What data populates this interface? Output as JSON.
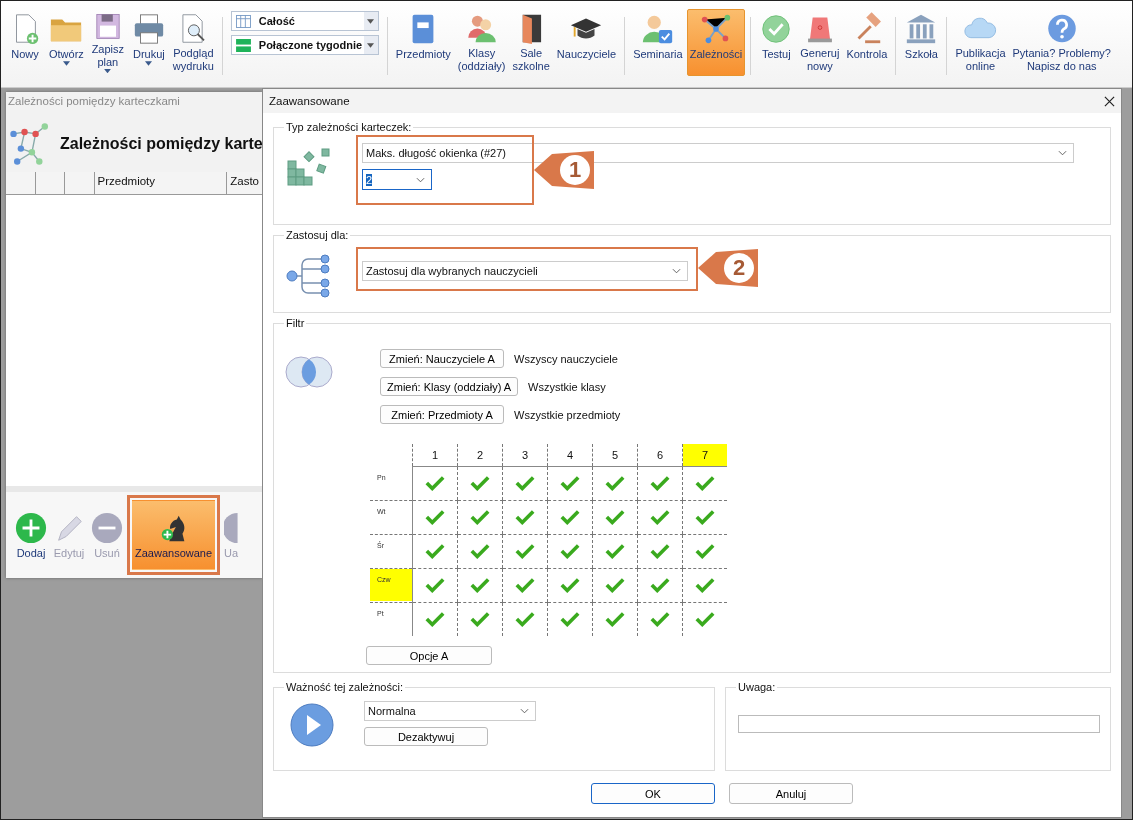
{
  "toolbar": {
    "groups": [
      [
        {
          "kind": "button",
          "label": "Nowy",
          "menu": false,
          "selected": false
        },
        {
          "kind": "button",
          "label": "Otwórz",
          "menu": true,
          "selected": false
        },
        {
          "kind": "button",
          "label": "Zapisz\nplan",
          "menu": true,
          "selected": false
        },
        {
          "kind": "button",
          "label": "Drukuj",
          "menu": true,
          "selected": false
        },
        {
          "kind": "button",
          "label": "Podgląd\nwydruku",
          "menu": false,
          "selected": false
        }
      ],
      [
        {
          "kind": "select",
          "value": "Całość"
        },
        {
          "kind": "select",
          "value": "Połączone tygodnie"
        }
      ],
      [
        {
          "kind": "button",
          "label": "Przedmioty",
          "menu": false,
          "selected": false
        },
        {
          "kind": "button",
          "label": "Klasy\n(oddziały)",
          "menu": false,
          "selected": false
        },
        {
          "kind": "button",
          "label": "Sale\nszkolne",
          "menu": false,
          "selected": false
        },
        {
          "kind": "button",
          "label": "Nauczyciele",
          "menu": false,
          "selected": false
        }
      ],
      [
        {
          "kind": "button",
          "label": "Seminaria",
          "menu": false,
          "selected": false
        },
        {
          "kind": "button",
          "label": "Zależności",
          "menu": false,
          "selected": true
        }
      ],
      [
        {
          "kind": "button",
          "label": "Testuj",
          "menu": false,
          "selected": false
        },
        {
          "kind": "button",
          "label": "Generuj\nnowy",
          "menu": false,
          "selected": false
        },
        {
          "kind": "button",
          "label": "Kontrola",
          "menu": false,
          "selected": false
        }
      ],
      [
        {
          "kind": "button",
          "label": "Szkoła",
          "menu": false,
          "selected": false
        }
      ],
      [
        {
          "kind": "button",
          "label": "Publikacja\nonline",
          "menu": false,
          "selected": false
        },
        {
          "kind": "button",
          "label": "Pytania? Problemy?\nNapisz do nas",
          "menu": false,
          "selected": false
        }
      ]
    ]
  },
  "panel": {
    "window_title": "Zależności pomiędzy karteczkami",
    "heading": "Zależności pomiędzy karte",
    "columns": [
      "Przedmioty",
      "Zasto"
    ],
    "buttons": [
      {
        "label": "Dodaj",
        "disabled": false,
        "selected": false
      },
      {
        "label": "Edytuj",
        "disabled": true,
        "selected": false
      },
      {
        "label": "Usuń",
        "disabled": true,
        "selected": false
      },
      {
        "label": "Zaawansowane",
        "disabled": false,
        "selected": true
      },
      {
        "label": "Ua",
        "disabled": true,
        "selected": false
      }
    ]
  },
  "dialog": {
    "title": "Zaawansowane",
    "type_group": {
      "legend": "Typ zależności karteczek:",
      "type": "Maks. długość okienka (#27)",
      "value": "2",
      "value_text_selected": true,
      "callout": "1"
    },
    "apply_group": {
      "legend": "Zastosuj dla:",
      "value": "Zastosuj dla wybranych nauczycieli",
      "callout": "2"
    },
    "filter": {
      "legend": "Filtr",
      "rows": [
        {
          "button": "Zmień: Nauczyciele A",
          "text": "Wszyscy nauczyciele"
        },
        {
          "button": "Zmień: Klasy (oddziały) A",
          "text": "Wszystkie klasy"
        },
        {
          "button": "Zmień: Przedmioty A",
          "text": "Wszystkie przedmioty"
        }
      ],
      "grid": {
        "columns": [
          {
            "label": "1",
            "highlighted": false
          },
          {
            "label": "2",
            "highlighted": false
          },
          {
            "label": "3",
            "highlighted": false
          },
          {
            "label": "4",
            "highlighted": false
          },
          {
            "label": "5",
            "highlighted": false
          },
          {
            "label": "6",
            "highlighted": false
          },
          {
            "label": "7",
            "highlighted": true
          }
        ],
        "rows": [
          {
            "label": "Pn",
            "highlighted": false,
            "cells": [
              {
                "checked": true
              },
              {
                "checked": true
              },
              {
                "checked": true
              },
              {
                "checked": true
              },
              {
                "checked": true
              },
              {
                "checked": true
              },
              {
                "checked": true
              }
            ]
          },
          {
            "label": "Wt",
            "highlighted": false,
            "cells": [
              {
                "checked": true
              },
              {
                "checked": true
              },
              {
                "checked": true
              },
              {
                "checked": true
              },
              {
                "checked": true
              },
              {
                "checked": true
              },
              {
                "checked": true
              }
            ]
          },
          {
            "label": "Śr",
            "highlighted": false,
            "cells": [
              {
                "checked": true
              },
              {
                "checked": true
              },
              {
                "checked": true
              },
              {
                "checked": true
              },
              {
                "checked": true
              },
              {
                "checked": true
              },
              {
                "checked": true
              }
            ]
          },
          {
            "label": "Czw",
            "highlighted": true,
            "cells": [
              {
                "checked": true
              },
              {
                "checked": true
              },
              {
                "checked": true
              },
              {
                "checked": true
              },
              {
                "checked": true
              },
              {
                "checked": true
              },
              {
                "checked": true
              }
            ]
          },
          {
            "label": "Pt",
            "highlighted": false,
            "cells": [
              {
                "checked": true
              },
              {
                "checked": true
              },
              {
                "checked": true
              },
              {
                "checked": true
              },
              {
                "checked": true
              },
              {
                "checked": true
              },
              {
                "checked": true
              }
            ]
          }
        ]
      },
      "options_button": "Opcje A"
    },
    "importance": {
      "legend": "Ważność tej zależności:",
      "value": "Normalna",
      "button": "Dezaktywuj"
    },
    "note": {
      "legend": "Uwaga:"
    },
    "buttons": [
      {
        "label": "OK",
        "default": true
      },
      {
        "label": "Anuluj",
        "default": false
      }
    ]
  }
}
